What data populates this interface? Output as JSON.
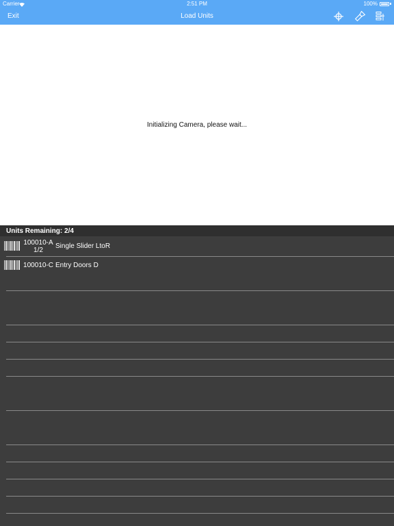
{
  "status": {
    "carrier": "Carrier",
    "time": "2:51 PM",
    "battery": "100%"
  },
  "nav": {
    "exit": "Exit",
    "title": "Load Units"
  },
  "camera": {
    "message": "Initializing Camera, please wait..."
  },
  "list_header": "Units Remaining: 2/4",
  "units": [
    {
      "code": "100010-A",
      "sub": "1/2",
      "desc": "Single Slider LtoR"
    },
    {
      "code": "100010-C",
      "sub": "",
      "desc": "Entry Doors D"
    }
  ],
  "colors": {
    "accent": "#5aa9f6",
    "list_bg": "#3d3d3d",
    "header_bg": "#2f2f2f"
  },
  "icons": [
    "crosshair-icon",
    "flashlight-icon",
    "settings-list-icon",
    "barcode-icon",
    "wifi-icon",
    "battery-icon"
  ]
}
